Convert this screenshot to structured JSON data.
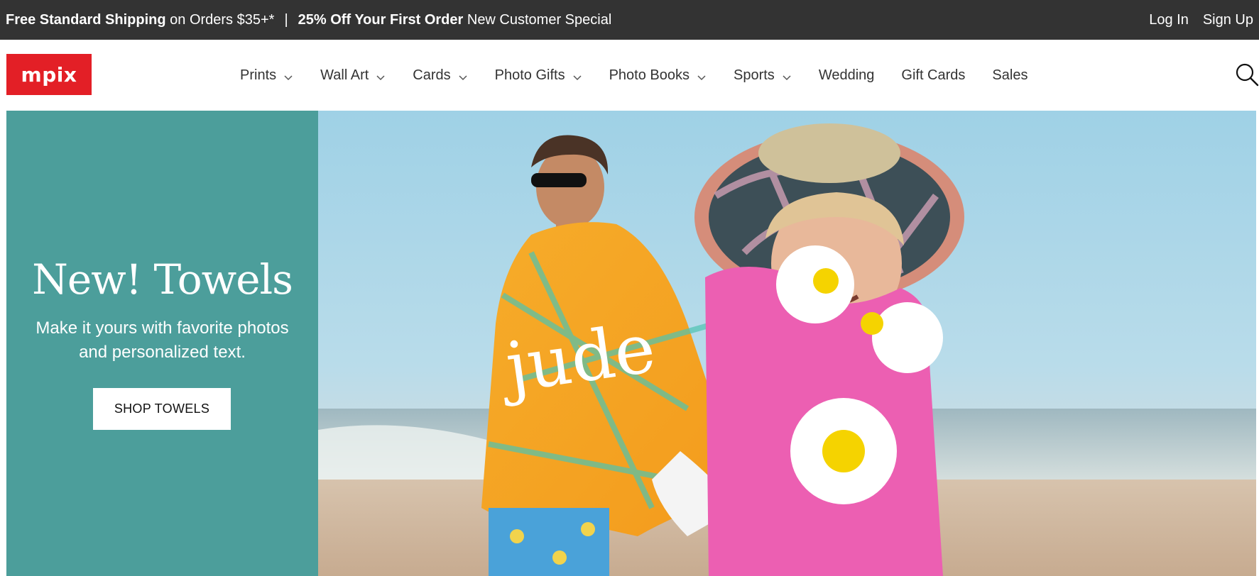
{
  "promo": {
    "shipping_bold": "Free Standard Shipping",
    "shipping_rest": " on Orders $35+*",
    "separator": "|",
    "discount_bold": "25% Off Your First Order",
    "discount_rest": " New Customer Special",
    "login": "Log In",
    "signup": "Sign Up"
  },
  "header": {
    "logo": "mpix",
    "nav": [
      {
        "label": "Prints",
        "has_dropdown": true
      },
      {
        "label": "Wall Art",
        "has_dropdown": true
      },
      {
        "label": "Cards",
        "has_dropdown": true
      },
      {
        "label": "Photo Gifts",
        "has_dropdown": true
      },
      {
        "label": "Photo Books",
        "has_dropdown": true
      },
      {
        "label": "Sports",
        "has_dropdown": true
      },
      {
        "label": "Wedding",
        "has_dropdown": false
      },
      {
        "label": "Gift Cards",
        "has_dropdown": false
      },
      {
        "label": "Sales",
        "has_dropdown": false
      }
    ],
    "search_icon": "search-icon"
  },
  "hero": {
    "title": "New! Towels",
    "subtitle": "Make it yours with favorite photos and personalized text.",
    "button": "SHOP TOWELS",
    "towel_text": "jude"
  },
  "colors": {
    "promo_bg": "#333333",
    "brand_red": "#e31f26",
    "hero_teal": "#4c9e9b"
  }
}
